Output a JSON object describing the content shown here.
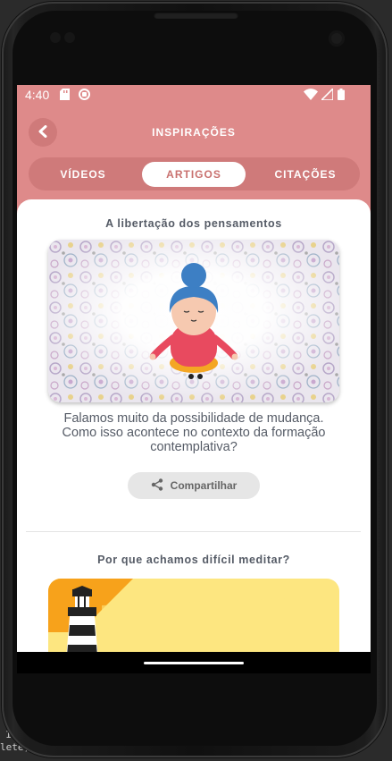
{
  "status_bar": {
    "time": "4:40",
    "icons": [
      "sd-card-icon",
      "android-debug-icon",
      "wifi-icon",
      "signal-icon",
      "battery-icon"
    ]
  },
  "toolbar": {
    "title": "INSPIRAÇÕES",
    "back_icon": "chevron-left-icon"
  },
  "tabs": [
    {
      "label": "VÍDEOS",
      "active": false
    },
    {
      "label": "ARTIGOS",
      "active": true
    },
    {
      "label": "CITAÇÕES",
      "active": false
    }
  ],
  "articles": [
    {
      "title": "A libertação dos pensamentos",
      "image": "meditating-woman-floral-illustration",
      "description_lines": [
        "Falamos muito da possibilidade de mudança.",
        "Como isso acontece no contexto da formação",
        "contemplativa?"
      ],
      "share_label": "Compartilhar",
      "share_icon": "share-icon"
    },
    {
      "title": "Por que achamos difícil meditar?",
      "image": "lighthouse-illustration"
    }
  ],
  "ide_background_text": [
    "1",
    "lete;"
  ],
  "colors": {
    "header_pink": "#de8a8a",
    "tab_bar": "#cf7a7a",
    "active_tab_text": "#c9716f",
    "text_gray": "#555b66"
  }
}
